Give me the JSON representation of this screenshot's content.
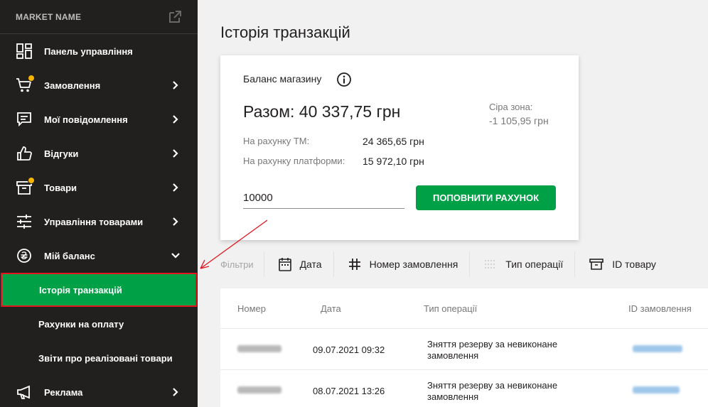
{
  "sidebar": {
    "market_name": "MARKET NAME",
    "items": [
      {
        "label": "Панель управління"
      },
      {
        "label": "Замовлення"
      },
      {
        "label": "Мої повідомлення"
      },
      {
        "label": "Відгуки"
      },
      {
        "label": "Товари"
      },
      {
        "label": "Управління товарами"
      },
      {
        "label": "Мій баланс"
      }
    ],
    "sub_items": [
      {
        "label": "Історія транзакцій"
      },
      {
        "label": "Рахунки на оплату"
      },
      {
        "label": "Звіти про реалізовані товари"
      }
    ],
    "last_item": {
      "label": "Реклама"
    }
  },
  "page_title": "Історія транзакцій",
  "balance": {
    "label": "Баланс магазину",
    "total": "Разом: 40 337,75 грн",
    "gray_zone_label": "Сіра зона:",
    "gray_zone_value": "-1 105,95 грн",
    "tm_label": "На рахунку ТМ:",
    "tm_value": "24 365,65 грн",
    "platform_label": "На рахунку платформи:",
    "platform_value": "15 972,10 грн",
    "input_value": "10000",
    "topup_button": "ПОПОВНИТИ РАХУНОК"
  },
  "filters": {
    "label": "Фільтри",
    "date": "Дата",
    "order_number": "Номер замовлення",
    "operation_type": "Тип операції",
    "product_id": "ID товару"
  },
  "table": {
    "columns": [
      "Номер",
      "Дата",
      "Тип операції",
      "ID замовлення"
    ],
    "rows": [
      {
        "date": "09.07.2021 09:32",
        "type_line1": "Зняття резерву за невиконане",
        "type_line2": "замовлення"
      },
      {
        "date": "08.07.2021 13:26",
        "type_line1": "Зняття резерву за невиконане",
        "type_line2": "замовлення"
      }
    ]
  },
  "colors": {
    "accent_green": "#00a046",
    "sidebar_bg": "#221f1f",
    "badge_yellow": "#f7b500",
    "annotation_red": "#e0141e"
  }
}
